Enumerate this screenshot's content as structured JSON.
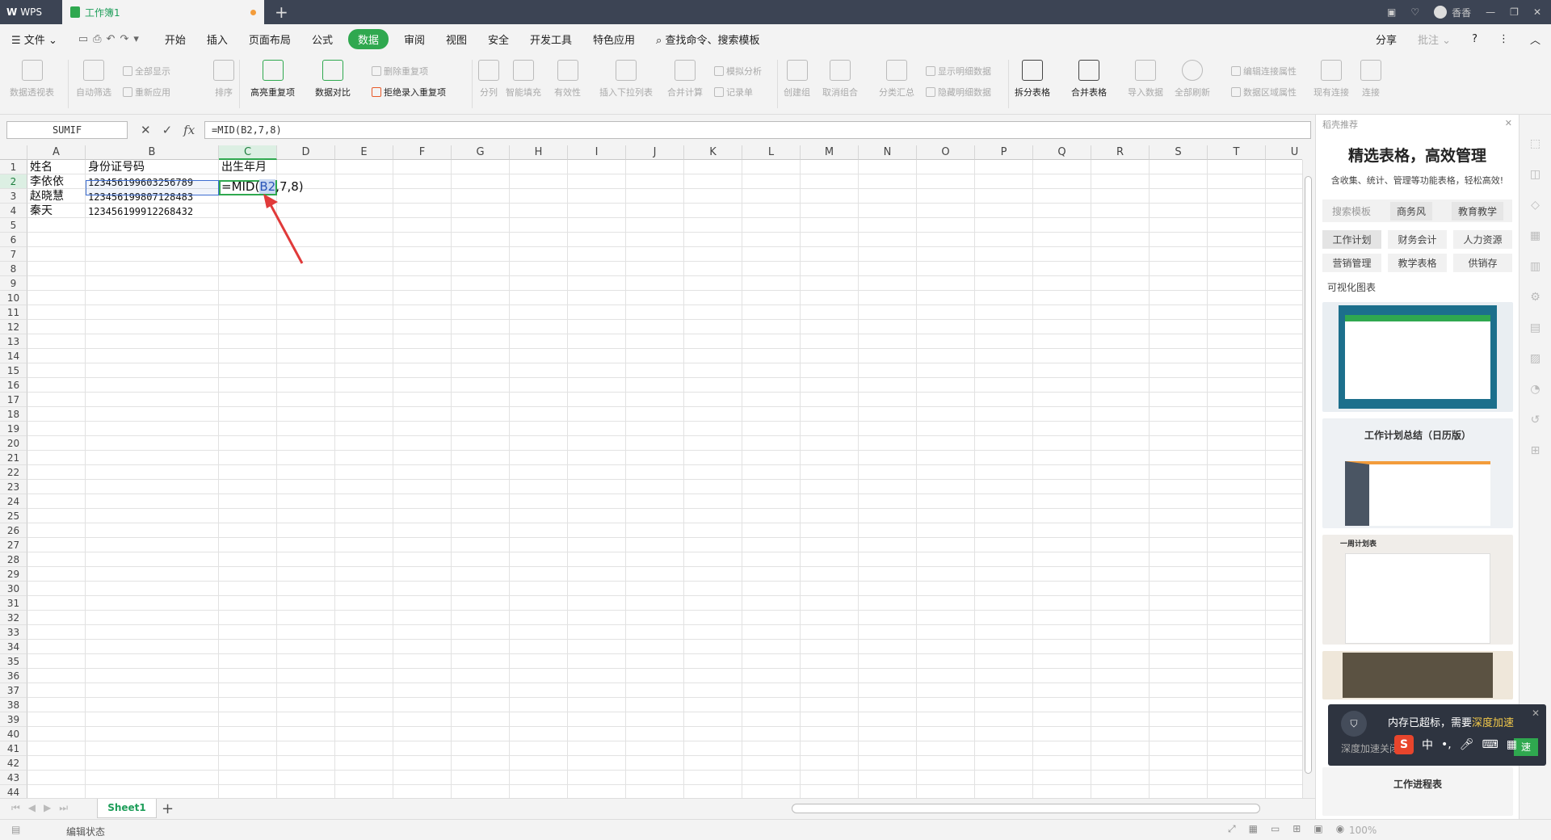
{
  "titlebar": {
    "app_tab": "WPS",
    "doc_tab": "工作簿1",
    "user": "香香"
  },
  "menu": {
    "file": "文件",
    "items": [
      "开始",
      "插入",
      "页面布局",
      "公式",
      "数据",
      "审阅",
      "视图",
      "安全",
      "开发工具",
      "特色应用"
    ],
    "active_index": 4,
    "search": "查找命令、搜索模板",
    "share": "分享",
    "comment": "批注"
  },
  "ribbon": {
    "pivot": "数据透视表",
    "autofilter": "自动筛选",
    "show_all": "全部显示",
    "reapply": "重新应用",
    "sort": "排序",
    "highlight_dup": "高亮重复项",
    "compare": "数据对比",
    "remove_dup": "删除重复项",
    "reject_dup": "拒绝录入重复项",
    "split_col": "分列",
    "smart_fill": "智能填充",
    "validity": "有效性",
    "dropdown": "插入下拉列表",
    "consolidate": "合并计算",
    "simulate": "模拟分析",
    "record": "记录单",
    "group": "创建组",
    "ungroup": "取消组合",
    "subtotal": "分类汇总",
    "show_detail": "显示明细数据",
    "hide_detail": "隐藏明细数据",
    "split_table": "拆分表格",
    "merge_table": "合并表格",
    "import": "导入数据",
    "refresh_all": "全部刷新",
    "edit_link": "编辑连接属性",
    "range_prop": "数据区域属性",
    "existing_conn": "现有连接",
    "conn": "连接"
  },
  "formula_bar": {
    "name_box": "SUMIF",
    "formula": "=MID(B2,7,8)"
  },
  "columns": [
    "A",
    "B",
    "C",
    "D",
    "E",
    "F",
    "G",
    "H",
    "I",
    "J",
    "K",
    "L",
    "M",
    "N",
    "O",
    "P",
    "Q",
    "R",
    "S",
    "T",
    "U"
  ],
  "rows": [
    "1",
    "2",
    "3",
    "4",
    "5",
    "6",
    "7",
    "8",
    "9",
    "10",
    "11",
    "12",
    "13",
    "14",
    "15",
    "16",
    "17",
    "18",
    "19",
    "20",
    "21",
    "22",
    "23",
    "24",
    "25",
    "26",
    "27",
    "28",
    "29",
    "30",
    "31",
    "32",
    "33",
    "34",
    "35",
    "36",
    "37",
    "38",
    "39",
    "40",
    "41",
    "42",
    "43",
    "44"
  ],
  "cells": {
    "A1": "姓名",
    "B1": "身份证号码",
    "C1": "出生年月",
    "A2": "李依依",
    "B2": "123456199603256789",
    "A3": "赵晓慧",
    "B3": "123456199807128483",
    "A4": "秦天",
    "B4": "123456199912268432"
  },
  "edit_cell": {
    "prefix": "=MID(",
    "ref": "B2",
    "suffix": ",7,8)"
  },
  "sheets": [
    "Sheet1"
  ],
  "status": {
    "mode": "编辑状态",
    "zoom": "100%"
  },
  "right_panel": {
    "header": "稻壳推荐",
    "title": "精选表格，高效管理",
    "subtitle": "含收集、统计、管理等功能表格，轻松高效!",
    "search_placeholder": "搜索模板",
    "search_tags": [
      "商务风",
      "教育教学"
    ],
    "tags": [
      "工作计划",
      "财务会计",
      "人力资源",
      "营销管理",
      "教学表格",
      "供销存"
    ],
    "section": "可视化图表",
    "thumb2_title": "工作计划总结（日历版）",
    "thumb3_title": "一周计划表",
    "thumb5_title": "工作进程表"
  },
  "toast": {
    "text": "内存已超标，需要",
    "highlight": "深度加速",
    "sub": "深度加速关闭",
    "button": "速"
  },
  "colors": {
    "accent": "#2fa84f",
    "ref_blue": "#3d6ed1",
    "arrow": "#e03a3a"
  }
}
